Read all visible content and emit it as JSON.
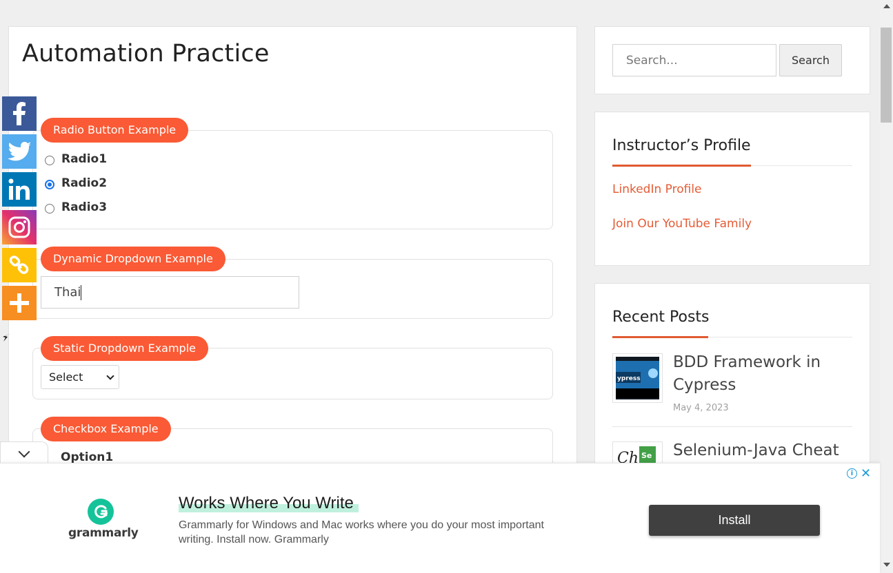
{
  "page": {
    "title": "Automation Practice"
  },
  "radio_section": {
    "label": "Radio Button Example",
    "options": [
      "Radio1",
      "Radio2",
      "Radio3"
    ],
    "selected": "Radio2"
  },
  "dynamic_dropdown": {
    "label": "Dynamic Dropdown Example",
    "value": "Thai"
  },
  "static_dropdown": {
    "label": "Static Dropdown Example",
    "selected": "Select"
  },
  "checkbox_section": {
    "label": "Checkbox Example",
    "options": [
      "Option1"
    ]
  },
  "social": [
    {
      "name": "facebook",
      "glyph": "f",
      "color": "#3b5998"
    },
    {
      "name": "twitter",
      "glyph": "t",
      "color": "#55acee"
    },
    {
      "name": "linkedin",
      "glyph": "in",
      "color": "#0077b5"
    },
    {
      "name": "instagram",
      "glyph": "◎",
      "color": "#c13584"
    },
    {
      "name": "copy-link",
      "glyph": "∞",
      "color": "#ffc107"
    },
    {
      "name": "more",
      "glyph": "+",
      "color": "#f78e21"
    }
  ],
  "sidebar": {
    "search": {
      "placeholder": "Search...",
      "button_label": "Search"
    },
    "profile": {
      "title": "Instructor’s Profile",
      "links": [
        "LinkedIn Profile",
        "Join Our YouTube Family"
      ]
    },
    "recent_posts": {
      "title": "Recent Posts",
      "posts": [
        {
          "title": "BDD Framework in Cypress",
          "date": "May 4, 2023"
        },
        {
          "title": "Selenium-Java Cheat",
          "date": ""
        }
      ]
    }
  },
  "ad": {
    "brand": "grammarly",
    "headline": "Works Where You Write",
    "body": "Grammarly for Windows and Mac works where you do your most important writing. Install now. Grammarly",
    "cta": "Install",
    "info_icon": "i",
    "close_icon": "✕"
  },
  "colors": {
    "accent": "#fa5a35",
    "link": "#e55b34",
    "grammarly": "#15c39a"
  }
}
